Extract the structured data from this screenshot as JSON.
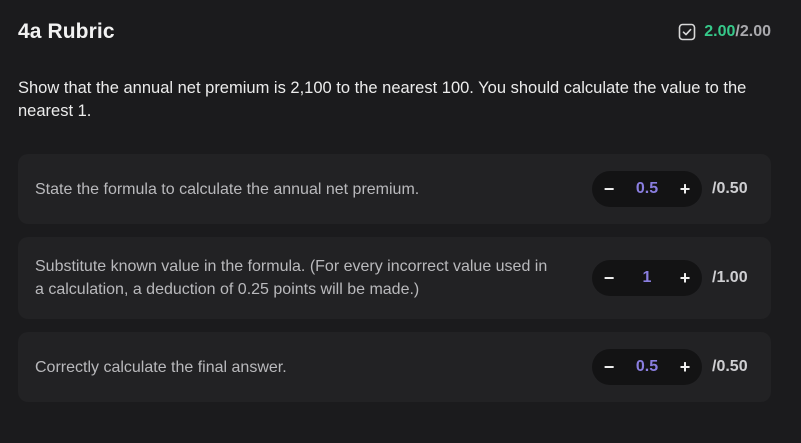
{
  "header": {
    "title": "4a Rubric",
    "score_earned": "2.00",
    "score_total": "/2.00",
    "icon": "checkbox-checked-icon",
    "accent_color": "#36c98a"
  },
  "question": "Show that the annual net premium is 2,100 to the nearest 100. You should calculate the value to the nearest 1.",
  "criteria": [
    {
      "text": "State the formula to calculate the annual net premium.",
      "minus": "−",
      "value": "0.5",
      "plus": "+",
      "max": "/0.50"
    },
    {
      "text": "Substitute known value in the formula. (For every incorrect value used in a calculation, a deduction of 0.25 points will be made.)",
      "minus": "−",
      "value": "1",
      "plus": "+",
      "max": "/1.00"
    },
    {
      "text": "Correctly calculate the final answer.",
      "minus": "−",
      "value": "0.5",
      "plus": "+",
      "max": "/0.50"
    }
  ]
}
